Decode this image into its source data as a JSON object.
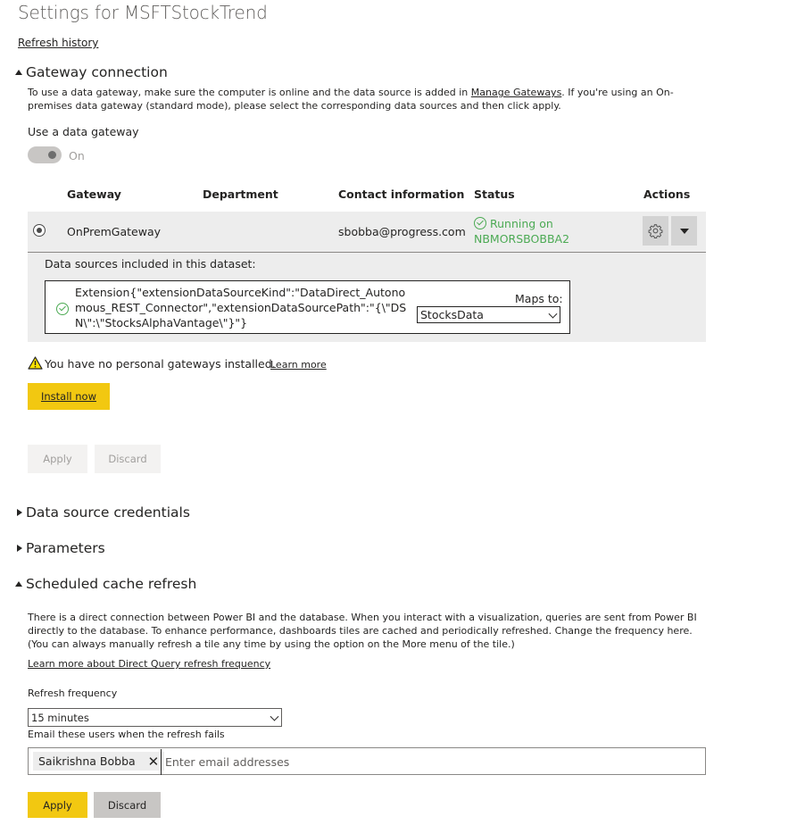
{
  "page": {
    "title": "Settings for MSFTStockTrend",
    "refresh_history_link": "Refresh history"
  },
  "gateway": {
    "header": "Gateway connection",
    "desc_part1": "To use a data gateway, make sure the computer is online and the data source is added in ",
    "desc_link": "Manage Gateways",
    "desc_part2": ". If you're using an On-premises data gateway (standard mode), please select the corresponding data sources and then click apply.",
    "use_gateway_label": "Use a data gateway",
    "toggle_state": "On",
    "columns": [
      "Gateway",
      "Department",
      "Contact information",
      "Status",
      "Actions"
    ],
    "row": {
      "gateway": "OnPremGateway",
      "department": "",
      "contact": "sbobba@progress.com",
      "status_line1": "Running on",
      "status_line2": "NBMORSBOBBA2"
    },
    "data_sources_label": "Data sources included in this dataset:",
    "data_source_text": "Extension{\"extensionDataSourceKind\":\"DataDirect_Autonomous_REST_Connector\",\"extensionDataSourcePath\":\"{\\\"DSN\\\":\\\"StocksAlphaVantage\\\"}\"}",
    "maps_to_label": "Maps to:",
    "maps_to_value": "StocksData",
    "no_personal_text": "You have no personal gateways installed.",
    "learn_more": "Learn more",
    "install_now": "Install now",
    "apply": "Apply",
    "discard": "Discard"
  },
  "sections": {
    "data_source_credentials": "Data source credentials",
    "parameters": "Parameters"
  },
  "scheduled": {
    "header": "Scheduled cache refresh",
    "desc": "There is a direct connection between Power BI and the database. When you interact with a visualization, queries are sent from Power BI directly to the database. To enhance performance, dashboards tiles are cached and periodically refreshed. Change the frequency here. (You can always manually refresh a tile any time by using the option on the More menu of the tile.)",
    "learn_more_link": "Learn more about Direct Query refresh frequency",
    "frequency_label": "Refresh frequency",
    "frequency_value": "15 minutes",
    "email_label": "Email these users when the refresh fails",
    "email_chip": "Saikrishna Bobba",
    "email_placeholder": "Enter email addresses",
    "apply": "Apply",
    "discard": "Discard"
  },
  "icons": {
    "warning": "warning-icon",
    "check": "check-circle-icon",
    "gear": "gear-icon",
    "caret": "caret-down-icon",
    "close": "close-icon"
  },
  "colors": {
    "accent_yellow": "#f2c811",
    "status_green": "#4caa54",
    "panel_gray": "#ededed"
  }
}
